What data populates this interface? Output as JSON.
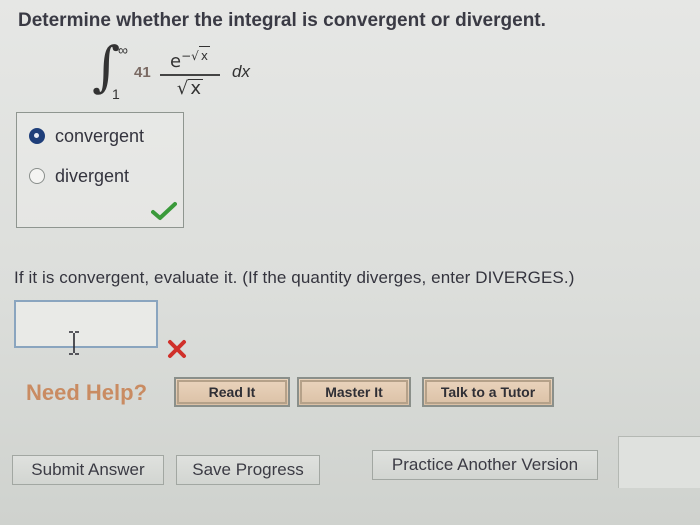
{
  "question": {
    "text": "Determine whether the integral is convergent or divergent."
  },
  "integral": {
    "upper_limit": "∞",
    "lower_limit": "1",
    "coefficient": "41",
    "numerator_base": "e",
    "numerator_exponent": "−√x",
    "numerator_sqrt_var": "x",
    "denominator_sqrt_var": "x",
    "differential": "dx"
  },
  "choices": {
    "items": [
      {
        "label": "convergent",
        "selected": true
      },
      {
        "label": "divergent",
        "selected": false
      }
    ],
    "result": "correct"
  },
  "evaluate": {
    "prompt": "If it is convergent, evaluate it. (If the quantity diverges, enter DIVERGES.)",
    "input_value": "",
    "result": "incorrect"
  },
  "help": {
    "label": "Need Help?",
    "buttons": [
      "Read It",
      "Master It",
      "Talk to a Tutor"
    ]
  },
  "actions": {
    "submit": "Submit Answer",
    "save": "Save Progress",
    "practice": "Practice Another Version"
  },
  "colors": {
    "selected_radio": "#1f3f7a",
    "check_green": "#3a9a3a",
    "cross_red": "#d0302a",
    "need_help": "#c98b62"
  }
}
